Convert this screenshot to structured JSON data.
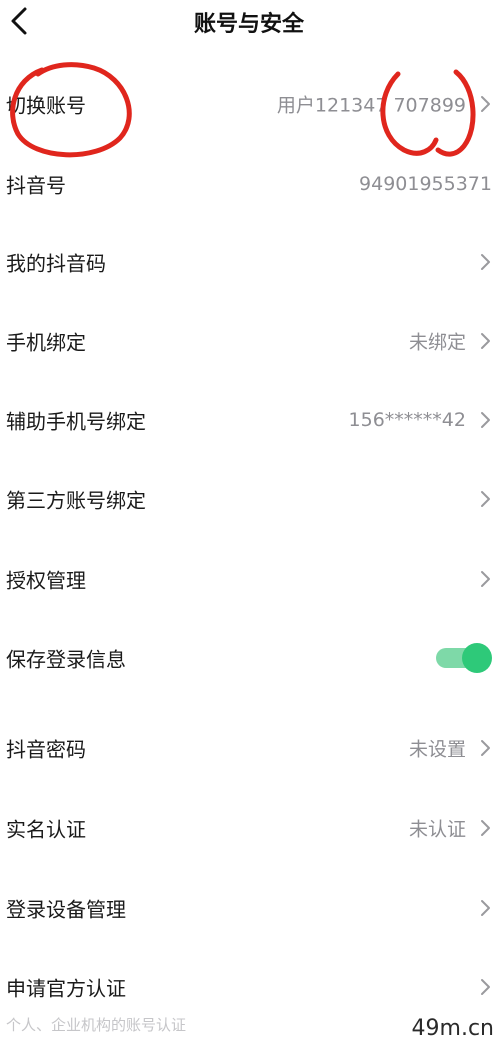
{
  "header": {
    "title": "账号与安全",
    "back_icon": "chevron-left-icon"
  },
  "rows": [
    {
      "label": "切换账号",
      "value": "用户121347 707899",
      "chevron": true
    },
    {
      "label": "抖音号",
      "value": "94901955371",
      "chevron": false
    },
    {
      "label": "我的抖音码",
      "value": "",
      "chevron": true
    },
    {
      "label": "手机绑定",
      "value": "未绑定",
      "chevron": true
    },
    {
      "label": "辅助手机号绑定",
      "value": "156******42",
      "chevron": true
    },
    {
      "label": "第三方账号绑定",
      "value": "",
      "chevron": true
    },
    {
      "label": "授权管理",
      "value": "",
      "chevron": true
    },
    {
      "label": "保存登录信息",
      "toggle": true,
      "toggle_on": true
    },
    {
      "label": "抖音密码",
      "value": "未设置",
      "chevron": true
    },
    {
      "label": "实名认证",
      "value": "未认证",
      "chevron": true
    },
    {
      "label": "登录设备管理",
      "value": "",
      "chevron": true
    },
    {
      "label": "申请官方认证",
      "value": "",
      "chevron": true
    }
  ],
  "official_cert_sub": "个人、企业机构的账号认证",
  "watermark": "49m.cn",
  "colors": {
    "accent_toggle": "#2ec979",
    "annotation_red": "#e0261d",
    "value_gray": "#8e8e93"
  }
}
